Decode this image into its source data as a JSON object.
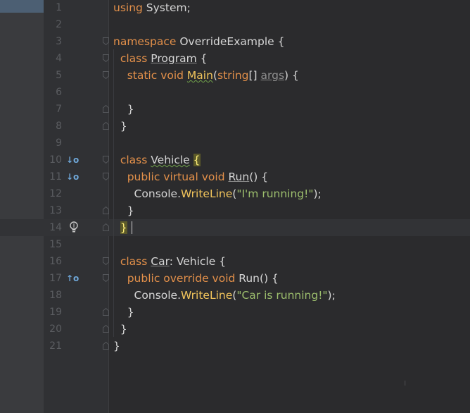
{
  "editor": {
    "lines": [
      {
        "n": "1",
        "segments": [
          {
            "t": "using ",
            "c": "kw"
          },
          {
            "t": "System;",
            "c": "id"
          }
        ]
      },
      {
        "n": "2",
        "segments": []
      },
      {
        "n": "3",
        "fold": "open",
        "segments": [
          {
            "t": "namespace ",
            "c": "kw"
          },
          {
            "t": "OverrideExample {",
            "c": "id"
          }
        ]
      },
      {
        "n": "4",
        "fold": "open",
        "segments": [
          {
            "t": "  class ",
            "c": "kw"
          },
          {
            "t": "Program",
            "c": "id plainund"
          },
          {
            "t": " {",
            "c": "id"
          }
        ]
      },
      {
        "n": "5",
        "fold": "open",
        "segments": [
          {
            "t": "    static void ",
            "c": "kw"
          },
          {
            "t": "Main",
            "c": "fn squig"
          },
          {
            "t": "(",
            "c": "id"
          },
          {
            "t": "string",
            "c": "kw"
          },
          {
            "t": "[] ",
            "c": "id"
          },
          {
            "t": "args",
            "c": "unused plainund"
          },
          {
            "t": ") {",
            "c": "id"
          }
        ]
      },
      {
        "n": "6",
        "segments": []
      },
      {
        "n": "7",
        "fold": "close",
        "segments": [
          {
            "t": "    }",
            "c": "id"
          }
        ]
      },
      {
        "n": "8",
        "fold": "close",
        "segments": [
          {
            "t": "  }",
            "c": "id"
          }
        ]
      },
      {
        "n": "9",
        "segments": []
      },
      {
        "n": "10",
        "marker": "↓o",
        "fold": "open",
        "segments": [
          {
            "t": "  class ",
            "c": "kw"
          },
          {
            "t": "Vehicle",
            "c": "id squig"
          },
          {
            "t": " ",
            "c": "id"
          },
          {
            "t": "{",
            "c": "brace-hl"
          }
        ]
      },
      {
        "n": "11",
        "marker": "↓o",
        "fold": "open",
        "segments": [
          {
            "t": "    public virtual void ",
            "c": "kw"
          },
          {
            "t": "Run",
            "c": "id plainund"
          },
          {
            "t": "() {",
            "c": "id"
          }
        ]
      },
      {
        "n": "12",
        "segments": [
          {
            "t": "      Console.",
            "c": "id"
          },
          {
            "t": "WriteLine",
            "c": "fn"
          },
          {
            "t": "(",
            "c": "id"
          },
          {
            "t": "\"I'm running!\"",
            "c": "str"
          },
          {
            "t": ");",
            "c": "id"
          }
        ]
      },
      {
        "n": "13",
        "fold": "close",
        "segments": [
          {
            "t": "    }",
            "c": "id"
          }
        ]
      },
      {
        "n": "14",
        "current": true,
        "bulb": true,
        "fold": "close",
        "segments": [
          {
            "t": "  ",
            "c": "id"
          },
          {
            "t": "}",
            "c": "brace-hl"
          }
        ]
      },
      {
        "n": "15",
        "segments": []
      },
      {
        "n": "16",
        "fold": "open",
        "segments": [
          {
            "t": "  class ",
            "c": "kw"
          },
          {
            "t": "Car",
            "c": "id plainund"
          },
          {
            "t": ": Vehicle {",
            "c": "id"
          }
        ]
      },
      {
        "n": "17",
        "marker": "↑o",
        "fold": "open",
        "segments": [
          {
            "t": "    public override void ",
            "c": "kw"
          },
          {
            "t": "Run",
            "c": "id"
          },
          {
            "t": "() {",
            "c": "id"
          }
        ]
      },
      {
        "n": "18",
        "segments": [
          {
            "t": "      Console.",
            "c": "id"
          },
          {
            "t": "WriteLine",
            "c": "fn"
          },
          {
            "t": "(",
            "c": "id"
          },
          {
            "t": "\"Car is running!\"",
            "c": "str"
          },
          {
            "t": ");",
            "c": "id"
          }
        ]
      },
      {
        "n": "19",
        "fold": "close",
        "segments": [
          {
            "t": "    }",
            "c": "id"
          }
        ]
      },
      {
        "n": "20",
        "fold": "close",
        "segments": [
          {
            "t": "  }",
            "c": "id"
          }
        ]
      },
      {
        "n": "21",
        "fold": "close",
        "segments": [
          {
            "t": "}",
            "c": "id"
          }
        ]
      }
    ]
  },
  "icons": {
    "bulb": "lightbulb-icon",
    "implemented_marker": "implemented-down-arrow-icon",
    "overrides_marker": "overrides-up-arrow-icon",
    "fold_open": "fold-open-icon",
    "fold_close": "fold-close-icon"
  },
  "colors": {
    "keyword": "#e3904a",
    "function": "#f2c55c",
    "string": "#9dbf6d",
    "background": "#2b2b2d",
    "marker": "#6fa7d8"
  }
}
